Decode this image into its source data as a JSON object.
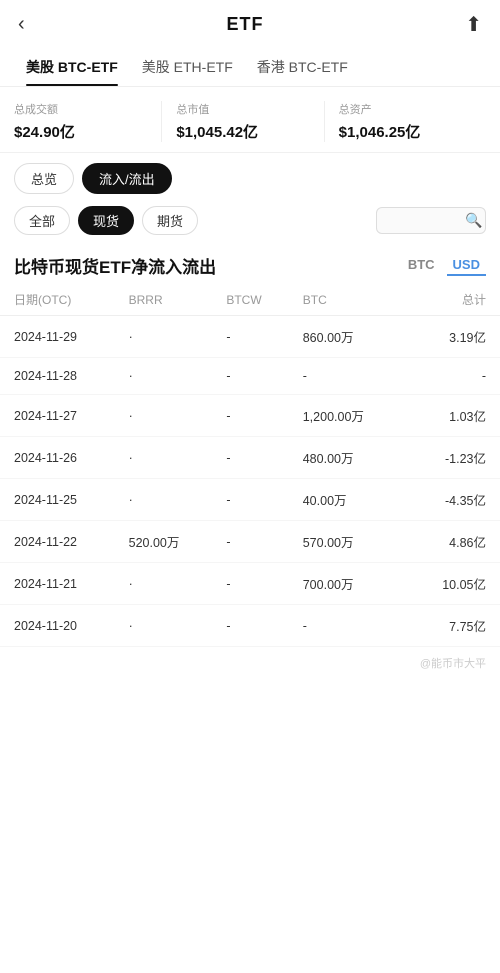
{
  "header": {
    "title": "ETF",
    "back_label": "‹",
    "share_label": "⬆"
  },
  "tabs_primary": [
    {
      "id": "btc-etf",
      "label": "美股 BTC-ETF",
      "active": true
    },
    {
      "id": "eth-etf",
      "label": "美股 ETH-ETF",
      "active": false
    },
    {
      "id": "hk-btc-etf",
      "label": "香港 BTC-ETF",
      "active": false
    }
  ],
  "stats": [
    {
      "label": "总成交额",
      "value": "$24.90亿"
    },
    {
      "label": "总市值",
      "value": "$1,045.42亿"
    },
    {
      "label": "总资产",
      "value": "$1,046.25亿"
    }
  ],
  "filter1": {
    "buttons": [
      {
        "label": "总览",
        "active": false
      },
      {
        "label": "流入/流出",
        "active": true
      }
    ]
  },
  "filter2": {
    "buttons": [
      {
        "label": "全部",
        "active": false
      },
      {
        "label": "现货",
        "active": true
      },
      {
        "label": "期货",
        "active": false
      }
    ],
    "search_placeholder": ""
  },
  "section": {
    "title": "比特币现货ETF净流入流出",
    "currency_btc": "BTC",
    "currency_usd": "USD"
  },
  "table": {
    "headers": [
      "日期(OTC)",
      "BRRR",
      "BTCW",
      "BTC",
      "总计"
    ],
    "rows": [
      {
        "date": "2024-11-29",
        "brrr": "·",
        "btcw": "-",
        "btc": "860.00万",
        "total": "3.19亿",
        "btc_color": "green",
        "total_color": "green"
      },
      {
        "date": "2024-11-28",
        "brrr": "·",
        "btcw": "-",
        "btc": "-",
        "total": "-",
        "btc_color": "muted",
        "total_color": "muted"
      },
      {
        "date": "2024-11-27",
        "brrr": "·",
        "btcw": "-",
        "btc": "1,200.00万",
        "total": "1.03亿",
        "btc_color": "green",
        "total_color": "green"
      },
      {
        "date": "2024-11-26",
        "brrr": "·",
        "btcw": "-",
        "btc": "480.00万",
        "total": "-1.23亿",
        "btc_color": "green",
        "total_color": "red"
      },
      {
        "date": "2024-11-25",
        "brrr": "·",
        "btcw": "-",
        "btc": "40.00万",
        "total": "-4.35亿",
        "btc_color": "green",
        "total_color": "red"
      },
      {
        "date": "2024-11-22",
        "brrr": "520.00万",
        "btcw": "-",
        "btc": "570.00万",
        "total": "4.86亿",
        "btc_color": "green",
        "total_color": "green"
      },
      {
        "date": "2024-11-21",
        "brrr": "·",
        "btcw": "-",
        "btc": "700.00万",
        "total": "10.05亿",
        "btc_color": "green",
        "total_color": "green"
      },
      {
        "date": "2024-11-20",
        "brrr": "·",
        "btcw": "-",
        "btc": "-",
        "total": "7.75亿",
        "btc_color": "muted",
        "total_color": "green"
      }
    ]
  },
  "watermark": "@能币市大平"
}
